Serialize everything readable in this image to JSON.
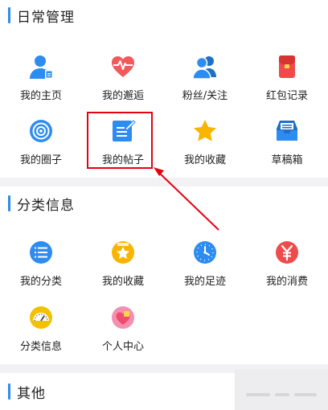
{
  "sections": {
    "daily": {
      "title": "日常管理",
      "items": [
        {
          "label": "我的主页",
          "icon": "user-profile-icon"
        },
        {
          "label": "我的邂逅",
          "icon": "heart-pulse-icon"
        },
        {
          "label": "粉丝/关注",
          "icon": "two-users-icon"
        },
        {
          "label": "红包记录",
          "icon": "red-packet-icon"
        },
        {
          "label": "我的圈子",
          "icon": "circle-target-icon"
        },
        {
          "label": "我的帖子",
          "icon": "edit-post-icon"
        },
        {
          "label": "我的收藏",
          "icon": "star-icon"
        },
        {
          "label": "草稿箱",
          "icon": "draft-box-icon"
        }
      ]
    },
    "classified": {
      "title": "分类信息",
      "items": [
        {
          "label": "我的分类",
          "icon": "list-category-icon"
        },
        {
          "label": "我的收藏",
          "icon": "star-badge-icon"
        },
        {
          "label": "我的足迹",
          "icon": "clock-icon"
        },
        {
          "label": "我的消费",
          "icon": "yen-icon"
        },
        {
          "label": "分类信息",
          "icon": "gauge-icon"
        },
        {
          "label": "个人中心",
          "icon": "heart-person-icon"
        }
      ]
    },
    "other": {
      "title": "其他"
    }
  },
  "colors": {
    "accent": "#2d8cf0",
    "highlight": "#e60012"
  }
}
